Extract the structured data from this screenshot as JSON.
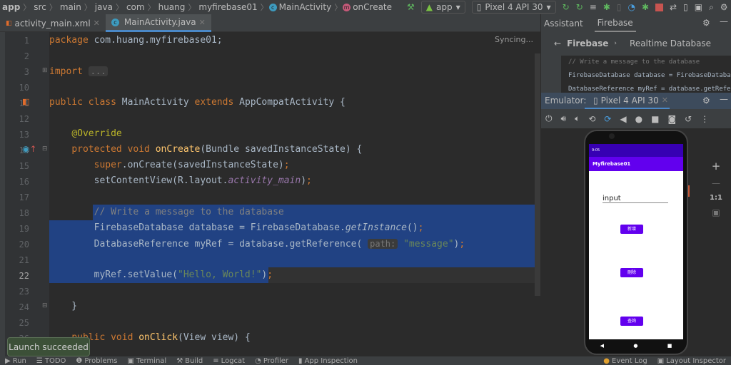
{
  "breadcrumb": [
    "app",
    "src",
    "main",
    "java",
    "com",
    "huang",
    "myfirebase01",
    "MainActivity",
    "onCreate"
  ],
  "toolbar": {
    "run_config": "app",
    "device": "Pixel 4 API 30"
  },
  "tabs": [
    {
      "label": "activity_main.xml"
    },
    {
      "label": "MainActivity.java",
      "active": true
    }
  ],
  "editor": {
    "status": "Syncing...",
    "line_numbers": [
      "1",
      "2",
      "3",
      "10",
      "11",
      "12",
      "13",
      "14",
      "15",
      "16",
      "17",
      "18",
      "19",
      "20",
      "21",
      "22",
      "23",
      "24",
      "25",
      "26"
    ],
    "current_line": "22",
    "param_hint": "path:"
  },
  "right_panel": {
    "tabs": [
      "Assistant",
      "Firebase"
    ],
    "back_label": "Firebase",
    "page_title": "Realtime Database",
    "snippet": [
      "// Write a message to the database",
      "FirebaseDatabase database = FirebaseDatabase.g",
      "DatabaseReference myRef = database.getReferenc"
    ]
  },
  "emulator": {
    "label": "Emulator:",
    "device_tab": "Pixel 4 API 30",
    "app_title": "Myfirebase01",
    "input_text": "input",
    "buttons": [
      "新增",
      "刪除",
      "查詢"
    ],
    "status_time": "9:05",
    "zoom_reset": "1:1"
  },
  "toast": "Launch succeeded",
  "statusbar": {
    "left": [
      "Run",
      "TODO",
      "Problems",
      "Terminal",
      "Build",
      "Logcat",
      "Profiler",
      "App Inspection"
    ],
    "right": [
      "Event Log",
      "Layout Inspector"
    ]
  },
  "colors": {
    "bg": "#2b2b2b",
    "selection": "#214283",
    "keyword": "#cc7832",
    "string": "#6a8759",
    "accent": "#6200ee"
  }
}
